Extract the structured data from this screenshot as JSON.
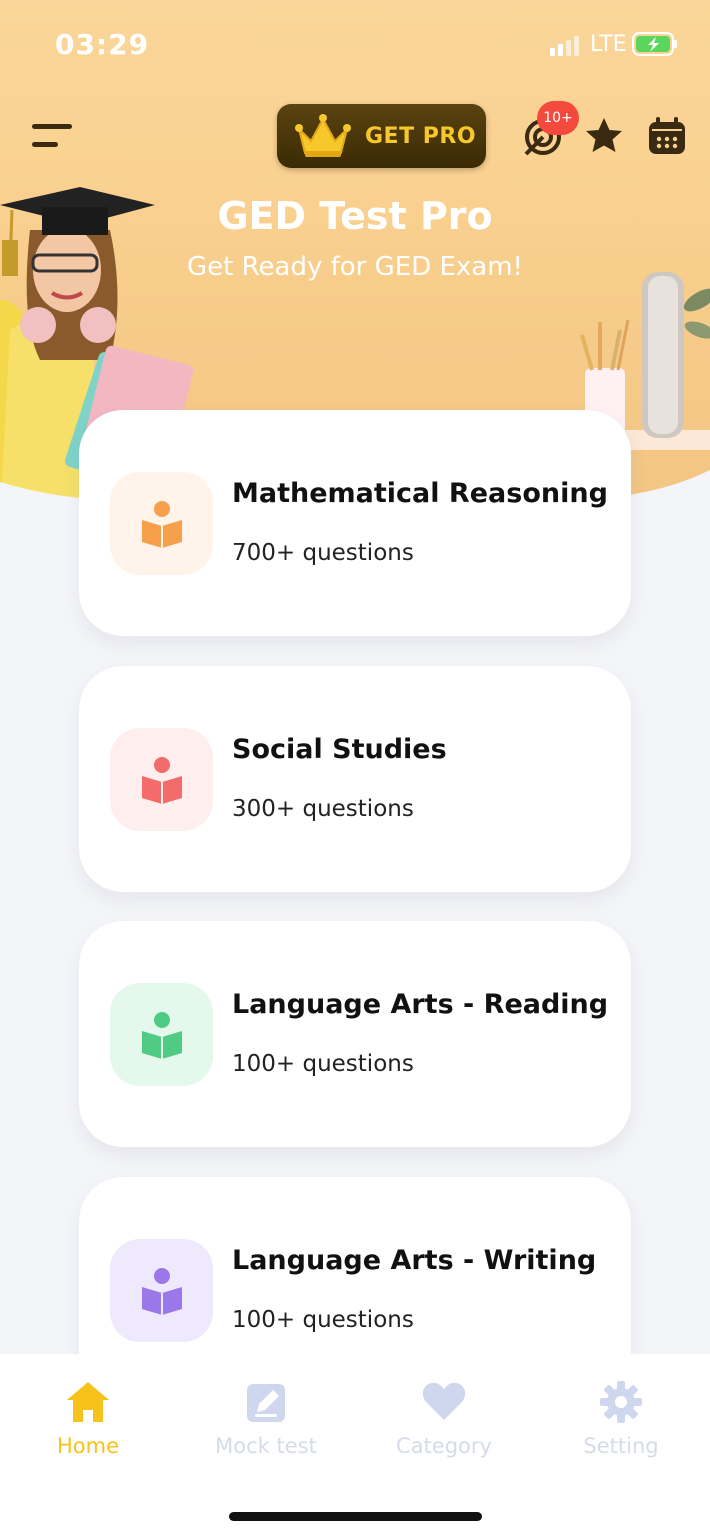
{
  "status_bar": {
    "time": "03:29",
    "network": "LTE"
  },
  "header": {
    "get_pro_label": "GET PRO",
    "notification_badge": "10+",
    "title": "GED Test Pro",
    "subtitle": "Get Ready for GED Exam!"
  },
  "subjects": [
    {
      "name": "Mathematical Reasoning",
      "count": "700+ questions",
      "color": "#f7a04c",
      "bg": "#fff3ea"
    },
    {
      "name": "Social Studies",
      "count": "300+ questions",
      "color": "#f36b6b",
      "bg": "#ffeeee"
    },
    {
      "name": "Language Arts - Reading",
      "count": "100+ questions",
      "color": "#4fcb84",
      "bg": "#e4f8ec"
    },
    {
      "name": "Language Arts - Writing",
      "count": "100+ questions",
      "color": "#9a78ea",
      "bg": "#efe9fd"
    }
  ],
  "bottom_nav": {
    "items": [
      {
        "label": "Home",
        "icon": "home-icon",
        "active": true
      },
      {
        "label": "Mock test",
        "icon": "edit-icon",
        "active": false
      },
      {
        "label": "Category",
        "icon": "heart-icon",
        "active": false
      },
      {
        "label": "Setting",
        "icon": "gear-icon",
        "active": false
      }
    ]
  },
  "colors": {
    "active": "#f7c21b",
    "inactive_icon": "#cfd7ee",
    "inactive_text": "#d5dbe9"
  }
}
